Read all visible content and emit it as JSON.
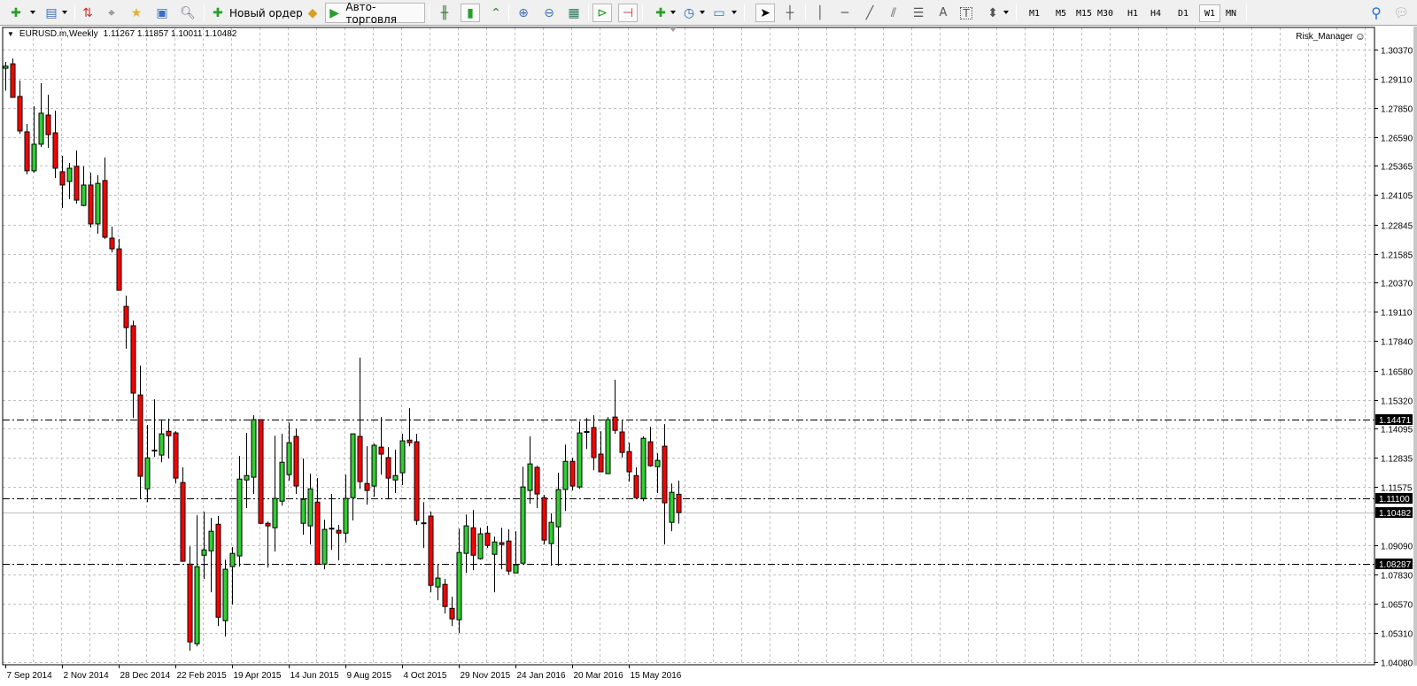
{
  "toolbar": {
    "new_order_label": "Новый ордер",
    "autotrading_label": "Авто-торговля",
    "timeframes": [
      "M1",
      "M5",
      "M15",
      "M30",
      "H1",
      "H4",
      "D1",
      "W1",
      "MN"
    ],
    "active_timeframe": "W1",
    "icons": [
      "new-chart",
      "profiles",
      "market-watch",
      "data-window",
      "navigator",
      "terminal",
      "strategy-tester",
      "new-order",
      "metaeditor",
      "autotrading",
      "bar-chart",
      "candlesticks",
      "line-chart",
      "zoom-in",
      "zoom-out",
      "tile-windows",
      "auto-scroll",
      "chart-shift",
      "indicators",
      "periods",
      "templates",
      "cursor",
      "crosshair",
      "vertical-line",
      "horizontal-line",
      "trendline",
      "equidistant-channel",
      "fibonacci",
      "text",
      "text-label",
      "arrows",
      "search",
      "chat"
    ]
  },
  "chart": {
    "symbol": "EURUSD.m,Weekly",
    "ohlc": "1.11267 1.11857 1.10011 1.10482",
    "expert": "Risk_Manager",
    "expert_icon": "smiley"
  },
  "chart_data": {
    "type": "candlestick",
    "period": "Weekly",
    "x_tick_labels": [
      "7 Sep 2014",
      "2 Nov 2014",
      "28 Dec 2014",
      "22 Feb 2015",
      "19 Apr 2015",
      "14 Jun 2015",
      "9 Aug 2015",
      "4 Oct 2015",
      "29 Nov 2015",
      "24 Jan 2016",
      "20 Mar 2016",
      "15 May 2016"
    ],
    "y_tick_labels": [
      "1.30370",
      "1.29110",
      "1.27850",
      "1.26590",
      "1.25365",
      "1.24105",
      "1.22845",
      "1.21585",
      "1.20370",
      "1.19110",
      "1.17840",
      "1.16580",
      "1.15320",
      "1.14095",
      "1.12835",
      "1.11575",
      "1.09090",
      "1.07830",
      "1.06570",
      "1.05310",
      "1.04080"
    ],
    "ylim": [
      1.0408,
      1.3037
    ],
    "grid": true,
    "horizontal_lines": [
      1.14471,
      1.111,
      1.08287
    ],
    "bid": 1.10482,
    "colors": {
      "bull": "#32CD32",
      "bear": "#FF0000",
      "grid": "#c0c0c0",
      "line": "#000000",
      "bid_line": "#c0c0c0"
    },
    "candles_ohlc": [
      [
        1.2955,
        1.2982,
        1.2859,
        1.2964
      ],
      [
        1.2974,
        1.2997,
        1.283,
        1.283
      ],
      [
        1.2834,
        1.2902,
        1.2674,
        1.2686
      ],
      [
        1.2682,
        1.2716,
        1.2499,
        1.2515
      ],
      [
        1.2515,
        1.2792,
        1.2507,
        1.2629
      ],
      [
        1.2629,
        1.2891,
        1.2617,
        1.2762
      ],
      [
        1.2754,
        1.2841,
        1.2613,
        1.267
      ],
      [
        1.2678,
        1.2773,
        1.2484,
        1.2526
      ],
      [
        1.2511,
        1.2579,
        1.2355,
        1.2454
      ],
      [
        1.2469,
        1.2549,
        1.2393,
        1.2526
      ],
      [
        1.2534,
        1.2602,
        1.2374,
        1.2389
      ],
      [
        1.2366,
        1.2534,
        1.2363,
        1.2454
      ],
      [
        1.2454,
        1.2507,
        1.2271,
        1.2287
      ],
      [
        1.2287,
        1.2496,
        1.2245,
        1.2461
      ],
      [
        1.2473,
        1.2572,
        1.2222,
        1.223
      ],
      [
        1.2226,
        1.2275,
        1.2165,
        1.218
      ],
      [
        1.218,
        1.2222,
        1.2002,
        1.2002
      ],
      [
        1.1933,
        1.1979,
        1.1751,
        1.1842
      ],
      [
        1.185,
        1.1872,
        1.1454,
        1.1561
      ],
      [
        1.1553,
        1.1679,
        1.1109,
        1.1204
      ],
      [
        1.115,
        1.1424,
        1.1093,
        1.1283
      ],
      [
        1.1314,
        1.1534,
        1.1287,
        1.1316
      ],
      [
        1.1295,
        1.1443,
        1.1264,
        1.1386
      ],
      [
        1.1397,
        1.1451,
        1.128,
        1.1378
      ],
      [
        1.139,
        1.1397,
        1.1173,
        1.1196
      ],
      [
        1.1177,
        1.1242,
        1.0839,
        1.0839
      ],
      [
        1.0827,
        1.0903,
        1.0455,
        1.0493
      ],
      [
        1.0485,
        1.1036,
        1.0474,
        1.0816
      ],
      [
        1.0865,
        1.1052,
        1.0763,
        1.0888
      ],
      [
        1.0884,
        1.1025,
        1.0706,
        1.0968
      ],
      [
        1.0998,
        1.1033,
        1.0561,
        1.0599
      ],
      [
        1.0584,
        1.0846,
        1.0516,
        1.0805
      ],
      [
        1.0816,
        1.09,
        1.0653,
        1.0873
      ],
      [
        1.0862,
        1.1291,
        1.0816,
        1.1192
      ],
      [
        1.1188,
        1.139,
        1.1067,
        1.1207
      ],
      [
        1.12,
        1.1466,
        1.1128,
        1.1447
      ],
      [
        1.1447,
        1.1447,
        1.0998,
        1.1002
      ],
      [
        1.1002,
        1.101,
        1.0812,
        1.0991
      ],
      [
        1.0983,
        1.1378,
        1.0881,
        1.1109
      ],
      [
        1.1097,
        1.1386,
        1.1078,
        1.1264
      ],
      [
        1.1211,
        1.1435,
        1.1185,
        1.1348
      ],
      [
        1.1375,
        1.1409,
        1.1128,
        1.1162
      ],
      [
        1.1002,
        1.128,
        1.0953,
        1.1105
      ],
      [
        1.0991,
        1.1215,
        1.0911,
        1.115
      ],
      [
        1.1093,
        1.1196,
        1.0827,
        1.0827
      ],
      [
        1.0827,
        1.1017,
        1.0805,
        1.0976
      ],
      [
        1.0979,
        1.1128,
        1.0888,
        1.0981
      ],
      [
        1.0972,
        1.0995,
        1.0843,
        1.096
      ],
      [
        1.096,
        1.1211,
        1.0919,
        1.1109
      ],
      [
        1.1112,
        1.1386,
        1.1014,
        1.1386
      ],
      [
        1.1375,
        1.1713,
        1.115,
        1.1181
      ],
      [
        1.1173,
        1.1333,
        1.1082,
        1.1143
      ],
      [
        1.1162,
        1.1344,
        1.1116,
        1.1337
      ],
      [
        1.1329,
        1.1458,
        1.1211,
        1.1299
      ],
      [
        1.1284,
        1.1329,
        1.1105,
        1.1196
      ],
      [
        1.1188,
        1.1318,
        1.1132,
        1.1207
      ],
      [
        1.1219,
        1.1386,
        1.1166,
        1.1356
      ],
      [
        1.1359,
        1.1496,
        1.1333,
        1.1348
      ],
      [
        1.1352,
        1.1386,
        1.0995,
        1.1014
      ],
      [
        1.1002,
        1.1093,
        1.0896,
        1.1004
      ],
      [
        1.1033,
        1.1052,
        1.0706,
        1.0736
      ],
      [
        1.0729,
        1.0827,
        1.0672,
        1.0767
      ],
      [
        1.074,
        1.0763,
        1.0615,
        1.0645
      ],
      [
        1.0637,
        1.0687,
        1.0561,
        1.0592
      ],
      [
        1.0588,
        1.0979,
        1.0531,
        1.0877
      ],
      [
        1.0873,
        1.104,
        1.0789,
        1.0991
      ],
      [
        1.0983,
        1.1059,
        1.0801,
        1.0865
      ],
      [
        1.085,
        1.0983,
        1.0846,
        1.0957
      ],
      [
        1.096,
        1.0991,
        1.0896,
        1.0907
      ],
      [
        1.0869,
        1.0945,
        1.0706,
        1.0922
      ],
      [
        1.0919,
        1.0983,
        1.0805,
        1.0911
      ],
      [
        1.0926,
        1.0976,
        1.0782,
        1.0797
      ],
      [
        1.0789,
        1.0968,
        1.0789,
        1.0824
      ],
      [
        1.0831,
        1.1245,
        1.0831,
        1.1158
      ],
      [
        1.1143,
        1.1375,
        1.1086,
        1.1257
      ],
      [
        1.1242,
        1.1249,
        1.1067,
        1.1128
      ],
      [
        1.1112,
        1.1124,
        1.0911,
        1.093
      ],
      [
        1.0915,
        1.1044,
        1.082,
        1.1006
      ],
      [
        1.0987,
        1.1219,
        1.082,
        1.1147
      ],
      [
        1.1147,
        1.134,
        1.1055,
        1.1268
      ],
      [
        1.1268,
        1.1283,
        1.1143,
        1.1162
      ],
      [
        1.1158,
        1.1439,
        1.115,
        1.139
      ],
      [
        1.1394,
        1.1454,
        1.1321,
        1.1396
      ],
      [
        1.1413,
        1.1466,
        1.123,
        1.1284
      ],
      [
        1.1299,
        1.1397,
        1.1223,
        1.1223
      ],
      [
        1.1215,
        1.1458,
        1.1215,
        1.1447
      ],
      [
        1.1458,
        1.1618,
        1.1386,
        1.1401
      ],
      [
        1.1394,
        1.1447,
        1.1284,
        1.1306
      ],
      [
        1.131,
        1.1348,
        1.1181,
        1.1223
      ],
      [
        1.1207,
        1.1242,
        1.1109,
        1.1112
      ],
      [
        1.1109,
        1.1375,
        1.1097,
        1.1367
      ],
      [
        1.1352,
        1.1416,
        1.1245,
        1.1249
      ],
      [
        1.1245,
        1.1302,
        1.1132,
        1.1272
      ],
      [
        1.1333,
        1.1428,
        1.0911,
        1.109
      ],
      [
        1.1006,
        1.1173,
        1.0968,
        1.1135
      ],
      [
        1.11267,
        1.11857,
        1.10011,
        1.10482
      ]
    ]
  }
}
